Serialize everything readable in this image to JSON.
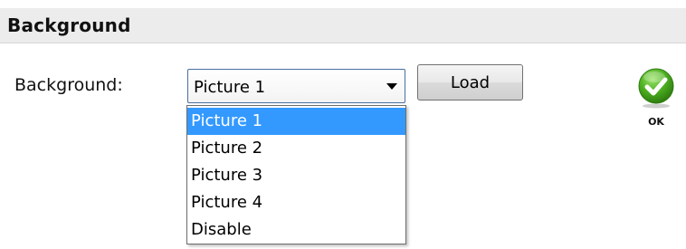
{
  "section": {
    "title": "Background"
  },
  "form": {
    "label": "Background:",
    "select": {
      "value": "Picture 1",
      "options": [
        {
          "label": "Picture 1",
          "selected": true
        },
        {
          "label": "Picture 2",
          "selected": false
        },
        {
          "label": "Picture 3",
          "selected": false
        },
        {
          "label": "Picture 4",
          "selected": false
        },
        {
          "label": "Disable",
          "selected": false
        }
      ]
    },
    "load_label": "Load"
  },
  "ok": {
    "label": "OK",
    "icon": "check-circle-icon",
    "color": "#4caf20"
  },
  "colors": {
    "selection": "#3399ff",
    "header_bg": "#ececec"
  }
}
